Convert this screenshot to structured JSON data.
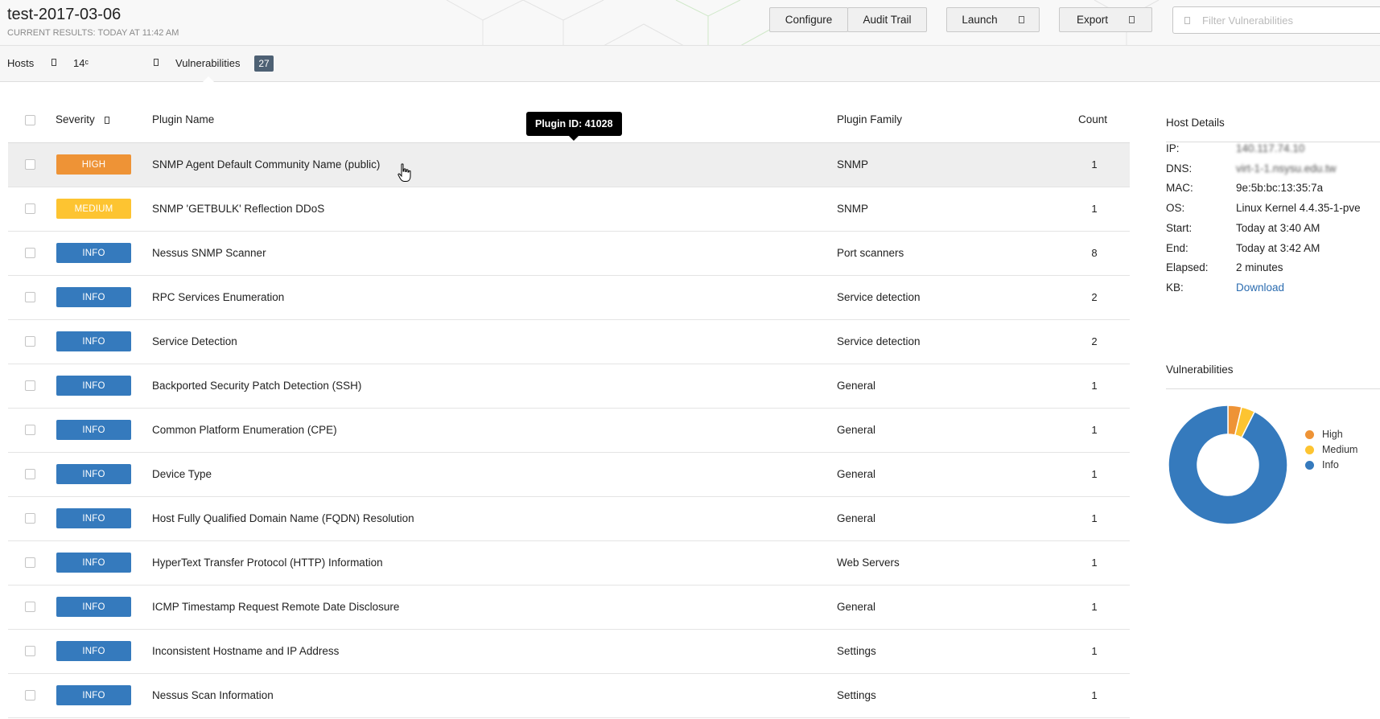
{
  "scan": {
    "title": "test-2017-03-06",
    "subtitle": "CURRENT RESULTS: TODAY AT 11:42 AM"
  },
  "toolbar": {
    "configure_label": "Configure",
    "audit_trail_label": "Audit Trail",
    "launch_label": "Launch",
    "export_label": "Export",
    "filter_placeholder": "Filter Vulnerabilities"
  },
  "tabs": {
    "hosts_label": "Hosts",
    "host_ip_fragment": "14ᶜ",
    "vulnerabilities_label": "Vulnerabilities",
    "vulnerabilities_count": "27"
  },
  "table": {
    "headers": {
      "severity": "Severity",
      "plugin_name": "Plugin Name",
      "plugin_family": "Plugin Family",
      "count": "Count"
    },
    "rows": [
      {
        "severity": "HIGH",
        "name": "SNMP Agent Default Community Name (public)",
        "family": "SNMP",
        "count": "1"
      },
      {
        "severity": "MEDIUM",
        "name": "SNMP 'GETBULK' Reflection DDoS",
        "family": "SNMP",
        "count": "1"
      },
      {
        "severity": "INFO",
        "name": "Nessus SNMP Scanner",
        "family": "Port scanners",
        "count": "8"
      },
      {
        "severity": "INFO",
        "name": "RPC Services Enumeration",
        "family": "Service detection",
        "count": "2"
      },
      {
        "severity": "INFO",
        "name": "Service Detection",
        "family": "Service detection",
        "count": "2"
      },
      {
        "severity": "INFO",
        "name": "Backported Security Patch Detection (SSH)",
        "family": "General",
        "count": "1"
      },
      {
        "severity": "INFO",
        "name": "Common Platform Enumeration (CPE)",
        "family": "General",
        "count": "1"
      },
      {
        "severity": "INFO",
        "name": "Device Type",
        "family": "General",
        "count": "1"
      },
      {
        "severity": "INFO",
        "name": "Host Fully Qualified Domain Name (FQDN) Resolution",
        "family": "General",
        "count": "1"
      },
      {
        "severity": "INFO",
        "name": "HyperText Transfer Protocol (HTTP) Information",
        "family": "Web Servers",
        "count": "1"
      },
      {
        "severity": "INFO",
        "name": "ICMP Timestamp Request Remote Date Disclosure",
        "family": "General",
        "count": "1"
      },
      {
        "severity": "INFO",
        "name": "Inconsistent Hostname and IP Address",
        "family": "Settings",
        "count": "1"
      },
      {
        "severity": "INFO",
        "name": "Nessus Scan Information",
        "family": "Settings",
        "count": "1"
      }
    ]
  },
  "tooltip": {
    "text": "Plugin ID: 41028"
  },
  "host_details": {
    "title": "Host Details",
    "fields": [
      {
        "label": "IP:",
        "value": "140.117.74.10",
        "blurred": true
      },
      {
        "label": "DNS:",
        "value": "virt-1-1.nsysu.edu.tw",
        "blurred": true
      },
      {
        "label": "MAC:",
        "value": "9e:5b:bc:13:35:7a"
      },
      {
        "label": "OS:",
        "value": "Linux Kernel 4.4.35-1-pve"
      },
      {
        "label": "Start:",
        "value": "Today at 3:40 AM"
      },
      {
        "label": "End:",
        "value": "Today at 3:42 AM"
      },
      {
        "label": "Elapsed:",
        "value": "2 minutes"
      },
      {
        "label": "KB:",
        "value": "Download",
        "link": true
      }
    ]
  },
  "vuln_summary": {
    "title": "Vulnerabilities",
    "legend": [
      {
        "label": "High",
        "color": "#ee9336",
        "count": 1
      },
      {
        "label": "Medium",
        "color": "#fdc431",
        "count": 1
      },
      {
        "label": "Info",
        "color": "#357abd",
        "count": 25
      }
    ]
  },
  "colors": {
    "HIGH": "#ee9336",
    "MEDIUM": "#fdc431",
    "INFO": "#357abd"
  }
}
